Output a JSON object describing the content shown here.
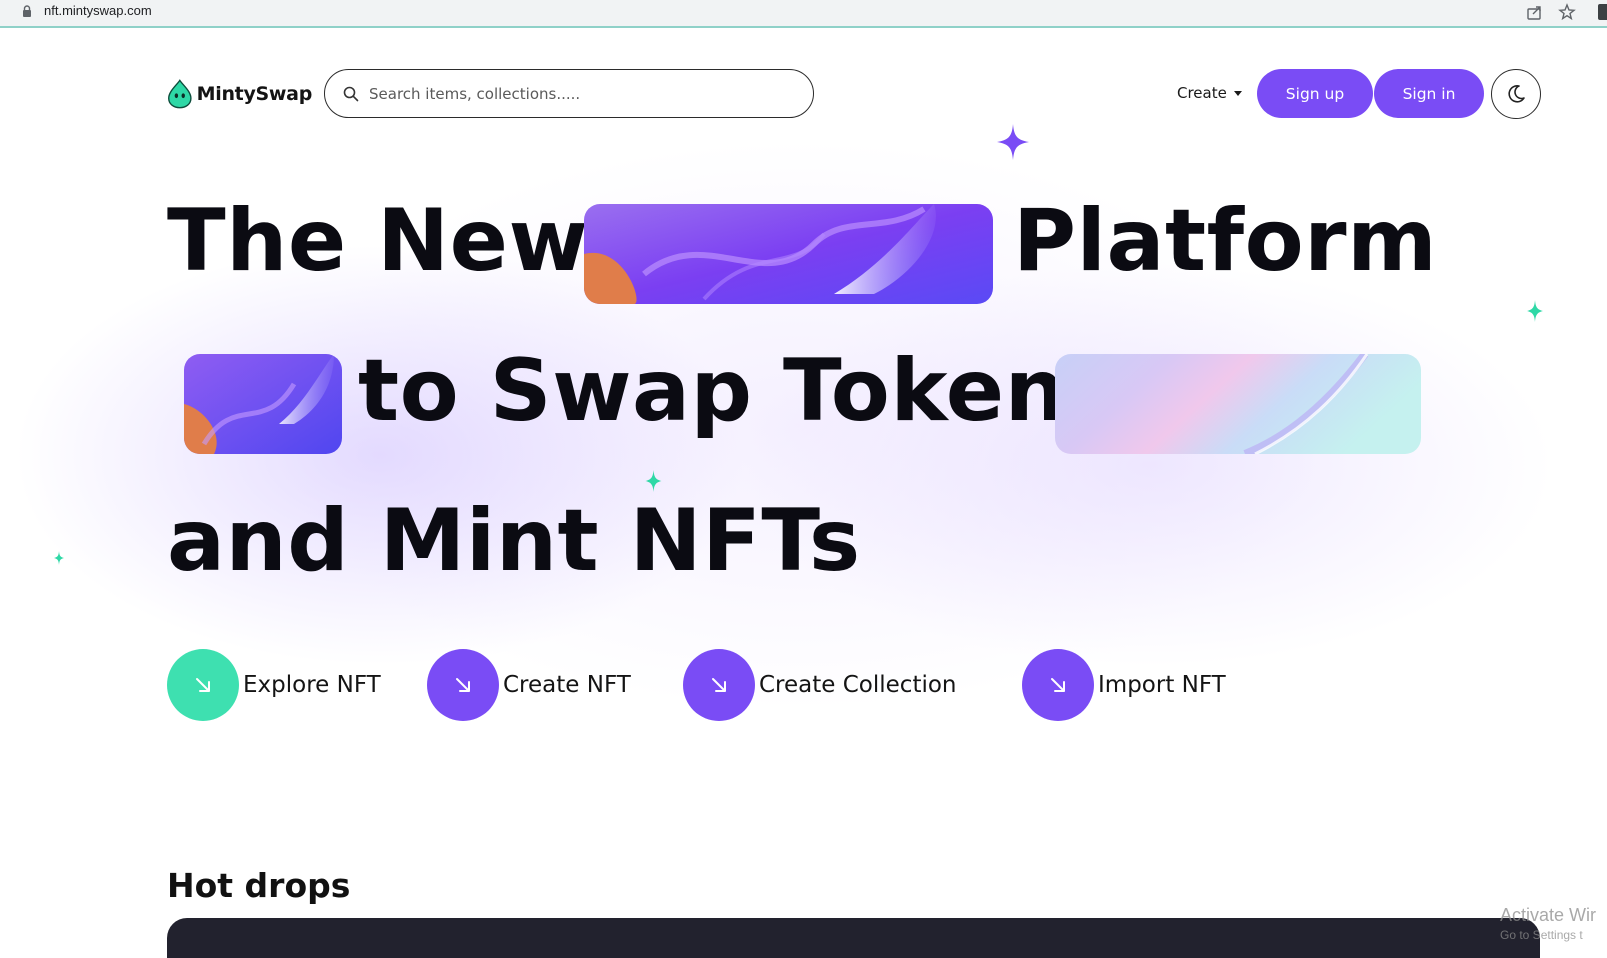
{
  "browser": {
    "url": "nft.mintyswap.com"
  },
  "nav": {
    "logo_text": "MintySwap",
    "search_placeholder": "Search items, collections.....",
    "create_label": "Create",
    "signup_label": "Sign up",
    "signin_label": "Sign in"
  },
  "hero": {
    "line1_part1": "The New",
    "line1_part2": "Platform",
    "line2": "to Swap Tokens",
    "line3": "and Mint NFTs"
  },
  "actions": [
    {
      "label": "Explore NFT",
      "color": "#3ee0b0",
      "icon": "arrow-down-right-icon"
    },
    {
      "label": "Create NFT",
      "color": "#7a4cf5",
      "icon": "arrow-down-right-icon"
    },
    {
      "label": "Create Collection",
      "color": "#7a4cf5",
      "icon": "arrow-down-right-icon"
    },
    {
      "label": "Import NFT",
      "color": "#7a4cf5",
      "icon": "arrow-down-right-icon"
    }
  ],
  "hot_drops": {
    "title": "Hot drops"
  },
  "os_watermark": {
    "line1": "Activate Wir",
    "line2": "Go to Settings t"
  },
  "colors": {
    "accent": "#7a4cf5",
    "mint": "#3ee0b0",
    "text": "#0b0b12"
  }
}
